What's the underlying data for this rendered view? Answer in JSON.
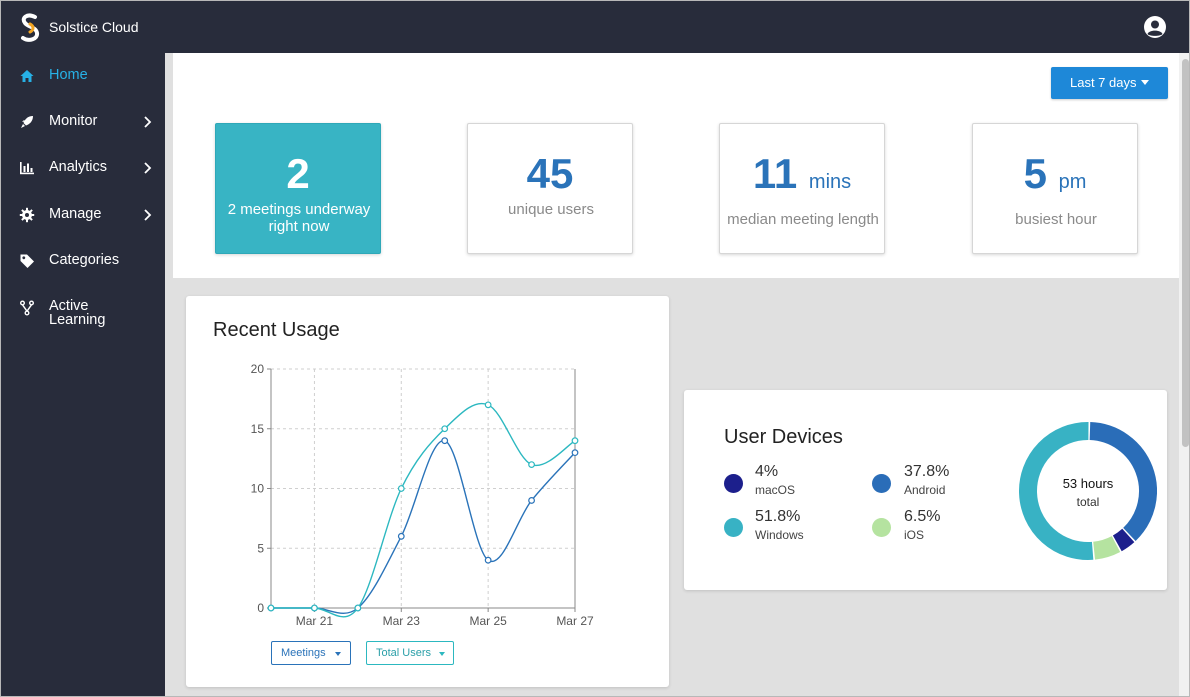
{
  "app": {
    "title": "Solstice Cloud",
    "account_icon": "account-circle-icon"
  },
  "sidebar": {
    "items": [
      {
        "label": "Home",
        "icon": "home-icon",
        "active": true
      },
      {
        "label": "Monitor",
        "icon": "rocket-icon",
        "has_submenu": true
      },
      {
        "label": "Analytics",
        "icon": "bar-chart-icon",
        "has_submenu": true
      },
      {
        "label": "Manage",
        "icon": "gear-icon",
        "has_submenu": true
      },
      {
        "label": "Categories",
        "icon": "tag-icon"
      },
      {
        "label": "Active Learning",
        "icon": "fork-icon"
      }
    ]
  },
  "toolbar": {
    "range_label": "Last 7 days"
  },
  "stats": [
    {
      "value": "2",
      "unit": "",
      "label": "2 meetings underway right now"
    },
    {
      "value": "45",
      "unit": "",
      "label": "unique users"
    },
    {
      "value": "11",
      "unit": "mins",
      "label": "median meeting length"
    },
    {
      "value": "5",
      "unit": "pm",
      "label": "busiest hour"
    }
  ],
  "recent_usage": {
    "title": "Recent Usage",
    "legend_buttons": [
      "Meetings",
      "Total Users"
    ]
  },
  "chart_data": {
    "type": "line",
    "title": "Recent Usage",
    "x": [
      "Mar 20",
      "Mar 21",
      "Mar 22",
      "Mar 23",
      "Mar 24",
      "Mar 25",
      "Mar 26",
      "Mar 27"
    ],
    "x_tick_labels": [
      "Mar 21",
      "Mar 23",
      "Mar 25",
      "Mar 27"
    ],
    "y_ticks": [
      0,
      5,
      10,
      15,
      20
    ],
    "ylim": [
      0,
      20
    ],
    "grid": true,
    "series": [
      {
        "name": "Meetings",
        "color": "#2a73b9",
        "values": [
          0,
          0,
          0,
          6,
          14,
          4,
          9,
          13
        ]
      },
      {
        "name": "Total Users",
        "color": "#2cb8c0",
        "values": [
          0,
          0,
          0,
          10,
          15,
          17,
          12,
          14
        ]
      }
    ]
  },
  "user_devices": {
    "title": "User Devices",
    "items": [
      {
        "pct": "4%",
        "name": "macOS",
        "color": "#1c1f8c",
        "value": 4.0
      },
      {
        "pct": "37.8%",
        "name": "Android",
        "color": "#2a6db8",
        "value": 37.8
      },
      {
        "pct": "51.8%",
        "name": "Windows",
        "color": "#38b2c4",
        "value": 51.8
      },
      {
        "pct": "6.5%",
        "name": "iOS",
        "color": "#b5e3a0",
        "value": 6.5
      }
    ],
    "total_value": "53 hours",
    "total_label": "total"
  },
  "colors": {
    "topbar": "#282c3b",
    "accent": "#1e88d8",
    "active_nav": "#27b1e6",
    "stat_teal": "#38b4c4",
    "stat_number": "#2a73b9"
  }
}
